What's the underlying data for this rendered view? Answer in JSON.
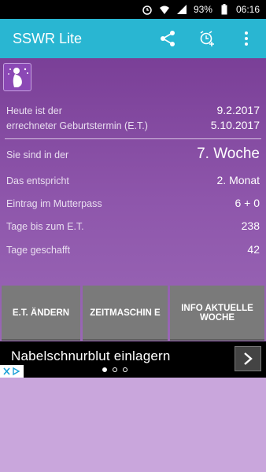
{
  "status": {
    "battery": "93%",
    "time": "06:16"
  },
  "appbar": {
    "title": "SSWR Lite"
  },
  "rows": [
    {
      "label": "Heute ist der",
      "value": "9.2.2017"
    },
    {
      "label": "errechneter Geburtstermin (E.T.)",
      "value": "5.10.2017"
    },
    {
      "label": "Sie sind in der",
      "value": "7. Woche"
    },
    {
      "label": "Das entspricht",
      "value": "2. Monat"
    },
    {
      "label": "Eintrag im Mutterpass",
      "value": "6 + 0"
    },
    {
      "label": "Tage bis zum E.T.",
      "value": "238"
    },
    {
      "label": "Tage geschafft",
      "value": "42"
    }
  ],
  "buttons": {
    "et_change": "E.T. ÄNDERN",
    "time_machine": "ZEITMASCHIN E",
    "info_week": "INFO AKTUELLE WOCHE"
  },
  "ad": {
    "text": "Nabelschnurblut einlagern"
  },
  "colors": {
    "appbar": "#29b6d2",
    "accent_purple": "#8e56ab",
    "button_gray": "#7a7a7a"
  }
}
